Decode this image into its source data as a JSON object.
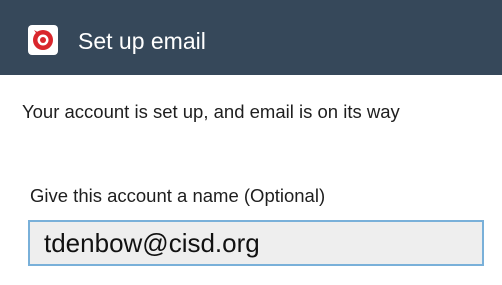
{
  "header": {
    "title": "Set up email",
    "icon": "email-app-icon"
  },
  "main": {
    "message": "Your account is set up, and email is on its way",
    "account_name": {
      "label": "Give this account a name (Optional)",
      "value": "tdenbow@cisd.org"
    }
  },
  "colors": {
    "action_bar": "#36485a",
    "input_border": "#79b0d9",
    "input_background": "#eeeeee",
    "icon_red": "#d9262c"
  }
}
